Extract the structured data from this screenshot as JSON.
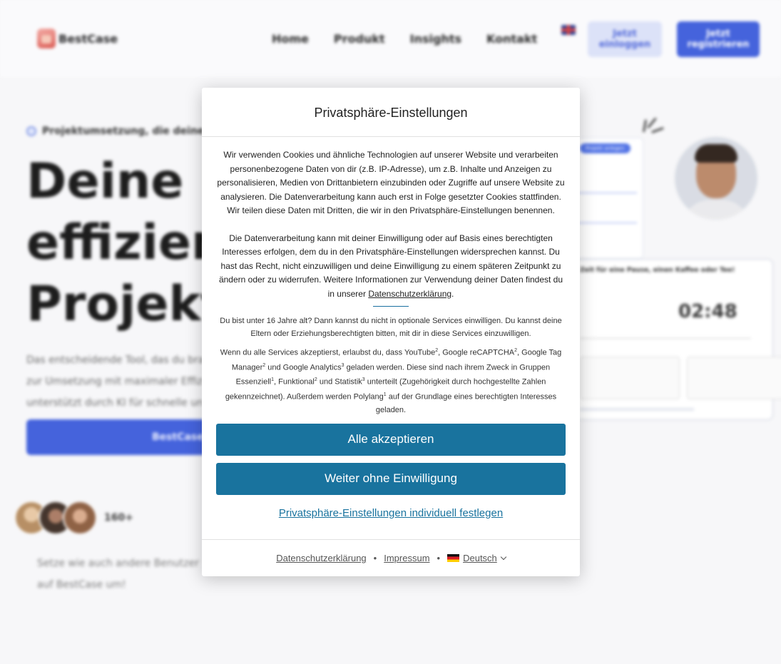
{
  "background": {
    "brand": "BestCase",
    "nav": [
      "Home",
      "Produkt",
      "Insights",
      "Kontakt"
    ],
    "login_label": "Jetzt einloggen",
    "register_label": "Jetzt registrieren",
    "eyebrow": "Projektumsetzung, die deine Ze",
    "hero_title": [
      "Deine N",
      "effizient",
      "Projektu"
    ],
    "hero_text": [
      "Das entscheidende Tool, das du brau",
      "zur Umsetzung mit maximaler Effizie",
      "unterstützt durch KI für schnelle un"
    ],
    "cta_label": "BestCase k",
    "avatar_count": "160+",
    "social_text": "Setze wie auch andere Benutzer auf BestCase um!",
    "mock": {
      "tag": "Projekt anlegen",
      "heading": "Zeit für eine Pause, einen Kaffee oder Tee!",
      "timer": "02:48"
    },
    "colors": {
      "brand_blue": "#3b5bdb",
      "dialog_button": "#19739e"
    }
  },
  "dialog": {
    "title": "Privatsphäre-Einstellungen",
    "p1": "Wir verwenden Cookies und ähnliche Technologien auf unserer Website und verarbeiten personenbezogene Daten von dir (z.B. IP-Adresse), um z.B. Inhalte und Anzeigen zu personalisieren, Medien von Drittanbietern einzubinden oder Zugriffe auf unsere Website zu analysieren. Die Datenverarbeitung kann auch erst in Folge gesetzter Cookies stattfinden. Wir teilen diese Daten mit Dritten, die wir in den Privatsphäre-Einstellungen benennen.",
    "p2": "Die Datenverarbeitung kann mit deiner Einwilligung oder auf Basis eines berechtigten Interesses erfolgen, dem du in den Privatsphäre-Einstellungen widersprechen kannst. Du hast das Recht, nicht einzuwilligen und deine Einwilligung zu einem späteren Zeitpunkt zu ändern oder zu widerrufen. Weitere Informationen zur Verwendung deiner Daten findest du in unserer",
    "p2_link": "Datenschutzerklärung",
    "p2_end": ".",
    "age_note": "Du bist unter 16 Jahre alt? Dann kannst du nicht in optionale Services einwilligen. Du kannst deine Eltern oder Erziehungsberechtigten bitten, mit dir in diese Services einzuwilligen.",
    "services": {
      "a": "Wenn du alle Services akzeptierst, erlaubst du, dass YouTube",
      "a_sup": "2",
      "b": ", Google reCAPTCHA",
      "b_sup": "2",
      "c": ", Google Tag Manager",
      "c_sup": "2",
      "d": " und Google Analytics",
      "d_sup": "3",
      "e": " geladen werden. Diese sind nach ihrem Zweck in Gruppen Essenziell",
      "e_sup": "1",
      "f": ", Funktional",
      "f_sup": "2",
      "g": " und Statistik",
      "g_sup": "3",
      "h": " unterteilt (Zugehörigkeit durch hochgestellte Zahlen gekennzeichnet). Außerdem werden Polylang",
      "h_sup": "1",
      "i": " auf der Grundlage eines berechtigten Interesses geladen."
    },
    "accept_all": "Alle akzeptieren",
    "continue_without": "Weiter ohne Einwilligung",
    "customize": "Privatsphäre-Einstellungen individuell festlegen",
    "footer": {
      "privacy": "Datenschutzerklärung",
      "sep": "•",
      "imprint": "Impressum",
      "language": "Deutsch"
    }
  }
}
